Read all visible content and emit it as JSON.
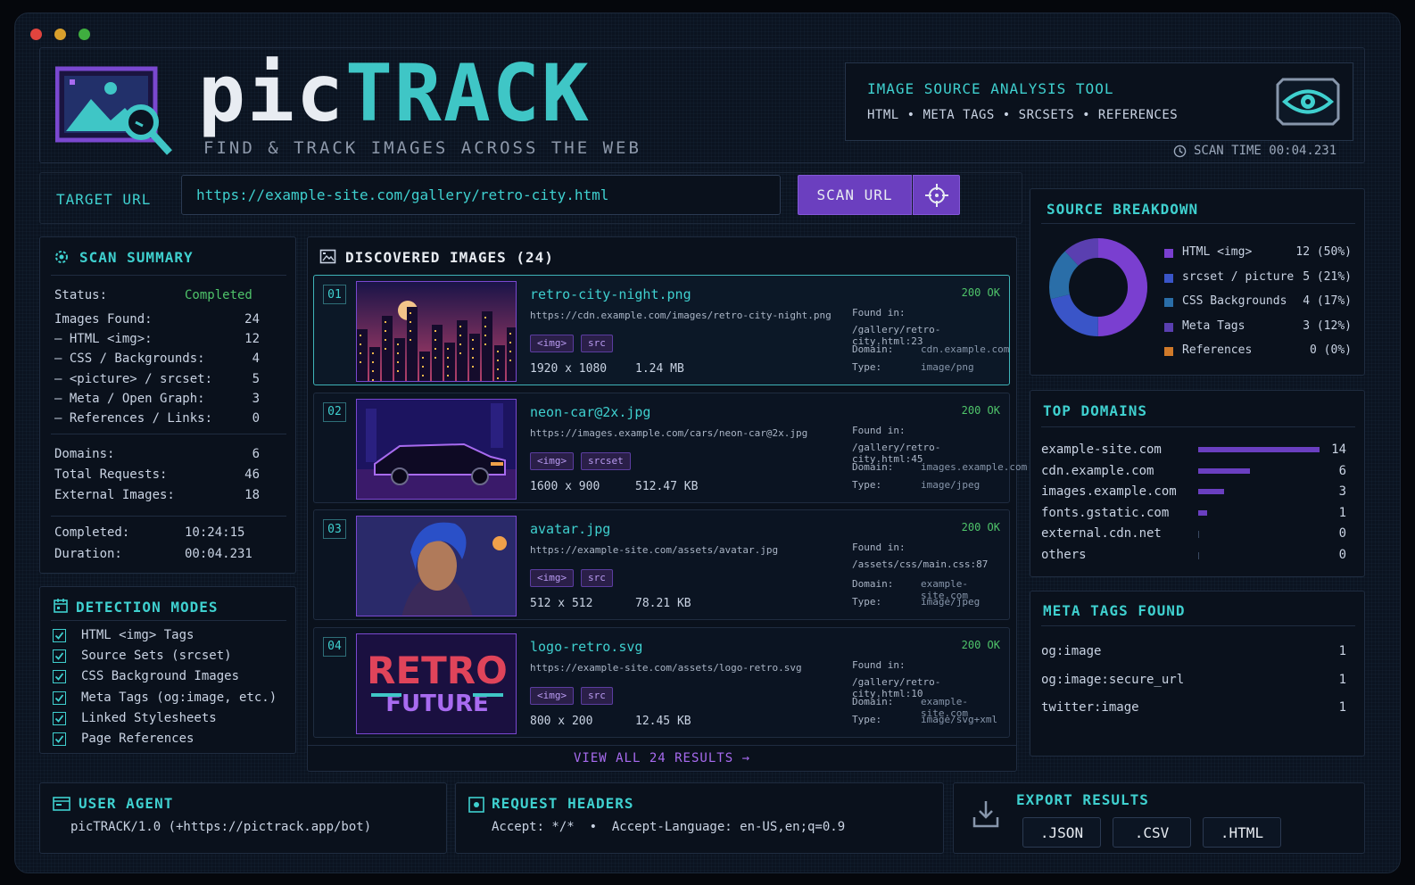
{
  "brand": {
    "pic": "pic",
    "track": "TRACK",
    "tagline": "FIND & TRACK IMAGES ACROSS THE WEB"
  },
  "tool": {
    "title": "IMAGE SOURCE ANALYSIS TOOL",
    "subtitle": "HTML • META TAGS • SRCSETS • REFERENCES"
  },
  "scan_time": "SCAN TIME 00:04.231",
  "url_bar": {
    "label": "TARGET URL",
    "value": "https://example-site.com/gallery/retro-city.html",
    "scan_label": "SCAN URL"
  },
  "summary": {
    "title": "SCAN SUMMARY",
    "status_label": "Status:",
    "status_value": "Completed",
    "rows": [
      {
        "label": "Images Found:",
        "value": "24"
      },
      {
        "label": "— HTML <img>:",
        "value": "12"
      },
      {
        "label": "— CSS / Backgrounds:",
        "value": "4"
      },
      {
        "label": "— <picture> / srcset:",
        "value": "5"
      },
      {
        "label": "— Meta / Open Graph:",
        "value": "3"
      },
      {
        "label": "— References / Links:",
        "value": "0"
      }
    ],
    "rows2": [
      {
        "label": "Domains:",
        "value": "6"
      },
      {
        "label": "Total Requests:",
        "value": "46"
      },
      {
        "label": "External Images:",
        "value": "18"
      }
    ],
    "completed_label": "Completed:",
    "completed_value": "10:24:15",
    "duration_label": "Duration:",
    "duration_value": "00:04.231"
  },
  "detection": {
    "title": "DETECTION MODES",
    "items": [
      "HTML <img> Tags",
      "Source Sets (srcset)",
      "CSS Background Images",
      "Meta Tags (og:image, etc.)",
      "Linked Stylesheets",
      "Page References"
    ]
  },
  "images": {
    "title": "DISCOVERED IMAGES (24)",
    "items": [
      {
        "num": "01",
        "name": "retro-city-night.png",
        "url": "https://cdn.example.com/images/retro-city-night.png",
        "tags": [
          "<img>",
          "src"
        ],
        "size": "1920 x 1080",
        "weight": "1.24 MB",
        "status": "200 OK",
        "found_label": "Found in:",
        "found": "/gallery/retro-city.html:23",
        "domain_label": "Domain:",
        "domain": "cdn.example.com",
        "type_label": "Type:",
        "type": "image/png"
      },
      {
        "num": "02",
        "name": "neon-car@2x.jpg",
        "url": "https://images.example.com/cars/neon-car@2x.jpg",
        "tags": [
          "<img>",
          "srcset"
        ],
        "size": "1600 x 900",
        "weight": "512.47 KB",
        "status": "200 OK",
        "found_label": "Found in:",
        "found": "/gallery/retro-city.html:45",
        "domain_label": "Domain:",
        "domain": "images.example.com",
        "type_label": "Type:",
        "type": "image/jpeg"
      },
      {
        "num": "03",
        "name": "avatar.jpg",
        "url": "https://example-site.com/assets/avatar.jpg",
        "tags": [
          "<img>",
          "src"
        ],
        "size": "512 x 512",
        "weight": "78.21 KB",
        "status": "200 OK",
        "found_label": "Found in:",
        "found": "/assets/css/main.css:87",
        "domain_label": "Domain:",
        "domain": "example-site.com",
        "type_label": "Type:",
        "type": "image/jpeg"
      },
      {
        "num": "04",
        "name": "logo-retro.svg",
        "url": "https://example-site.com/assets/logo-retro.svg",
        "tags": [
          "<img>",
          "src"
        ],
        "size": "800 x 200",
        "weight": "12.45 KB",
        "status": "200 OK",
        "found_label": "Found in:",
        "found": "/gallery/retro-city.html:10",
        "domain_label": "Domain:",
        "domain": "example-site.com",
        "type_label": "Type:",
        "type": "image/svg+xml"
      }
    ],
    "logo_line1": "RETRO",
    "logo_line2": "FUTURE",
    "view_all": "VIEW ALL 24 RESULTS"
  },
  "breakdown": {
    "title": "SOURCE BREAKDOWN",
    "items": [
      {
        "label": "HTML <img>",
        "value": "12 (50%)",
        "color": "#7a3fd0",
        "pct": 50
      },
      {
        "label": "srcset / picture",
        "value": "5 (21%)",
        "color": "#3a55c8",
        "pct": 21
      },
      {
        "label": "CSS Backgrounds",
        "value": "4 (17%)",
        "color": "#2a6ea8",
        "pct": 17
      },
      {
        "label": "Meta Tags",
        "value": "3 (12%)",
        "color": "#5a3fb0",
        "pct": 12
      },
      {
        "label": "References",
        "value": "0 (0%)",
        "color": "#d07a2a",
        "pct": 0
      }
    ]
  },
  "domains": {
    "title": "TOP DOMAINS",
    "items": [
      {
        "name": "example-site.com",
        "count": "14",
        "value": 14
      },
      {
        "name": "cdn.example.com",
        "count": "6",
        "value": 6
      },
      {
        "name": "images.example.com",
        "count": "3",
        "value": 3
      },
      {
        "name": "fonts.gstatic.com",
        "count": "1",
        "value": 1
      },
      {
        "name": "external.cdn.net",
        "count": "0",
        "value": 0
      },
      {
        "name": "others",
        "count": "0",
        "value": 0
      }
    ]
  },
  "meta_tags": {
    "title": "META TAGS FOUND",
    "items": [
      {
        "name": "og:image",
        "count": "1"
      },
      {
        "name": "og:image:secure_url",
        "count": "1"
      },
      {
        "name": "twitter:image",
        "count": "1"
      }
    ]
  },
  "footer": {
    "ua_title": "USER AGENT",
    "ua_value": "picTRACK/1.0 (+https://pictrack.app/bot)",
    "headers_title": "REQUEST HEADERS",
    "headers_value": "Accept: */*  •  Accept-Language: en-US,en;q=0.9",
    "export_title": "EXPORT RESULTS",
    "export_buttons": [
      ".JSON",
      ".CSV",
      ".HTML"
    ]
  }
}
